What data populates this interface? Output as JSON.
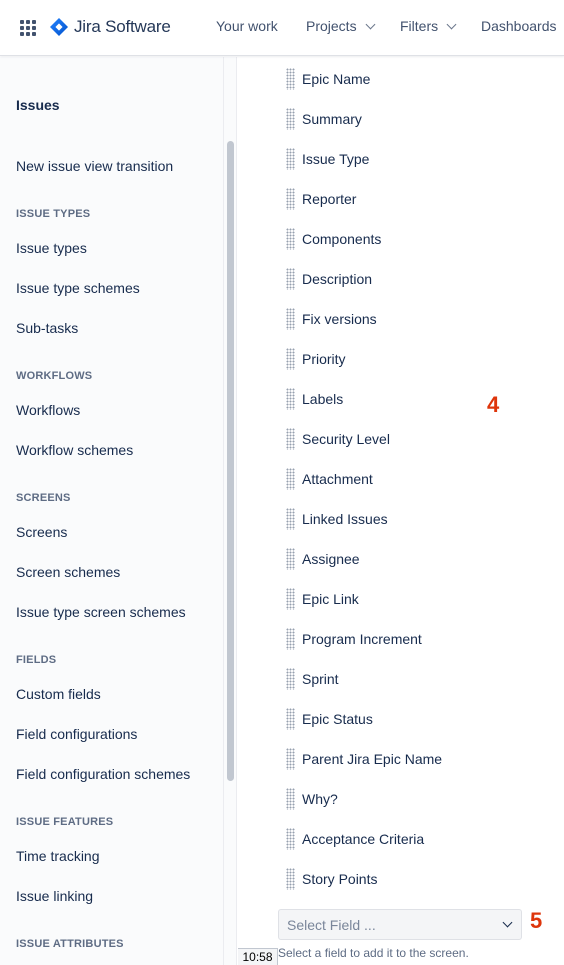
{
  "topnav": {
    "app_name": "Jira Software",
    "items": [
      {
        "label": "Your work",
        "dropdown": false
      },
      {
        "label": "Projects",
        "dropdown": true
      },
      {
        "label": "Filters",
        "dropdown": true
      },
      {
        "label": "Dashboards",
        "dropdown": false
      }
    ]
  },
  "sidebar": {
    "title": "Issues",
    "transition_link": "New issue view transition",
    "sections": [
      {
        "heading": "ISSUE TYPES",
        "items": [
          "Issue types",
          "Issue type schemes",
          "Sub-tasks"
        ]
      },
      {
        "heading": "WORKFLOWS",
        "items": [
          "Workflows",
          "Workflow schemes"
        ]
      },
      {
        "heading": "SCREENS",
        "items": [
          "Screens",
          "Screen schemes",
          "Issue type screen schemes"
        ]
      },
      {
        "heading": "FIELDS",
        "items": [
          "Custom fields",
          "Field configurations",
          "Field configuration schemes"
        ]
      },
      {
        "heading": "ISSUE FEATURES",
        "items": [
          "Time tracking",
          "Issue linking"
        ]
      },
      {
        "heading": "ISSUE ATTRIBUTES",
        "items": []
      }
    ]
  },
  "fields": [
    "Epic Name",
    "Summary",
    "Issue Type",
    "Reporter",
    "Components",
    "Description",
    "Fix versions",
    "Priority",
    "Labels",
    "Security Level",
    "Attachment",
    "Linked Issues",
    "Assignee",
    "Epic Link",
    "Program Increment",
    "Sprint",
    "Epic Status",
    "Parent Jira Epic Name",
    "Why?",
    "Acceptance Criteria",
    "Story Points"
  ],
  "annotations": {
    "fields_marker": "4",
    "select_marker": "5"
  },
  "select_field": {
    "placeholder": "Select Field ..."
  },
  "help_text": "Select a field to add it to the screen.",
  "clock": "10:58",
  "colors": {
    "brand": "#2684FF",
    "annotation": "#DE350B",
    "text": "#172B4D"
  }
}
